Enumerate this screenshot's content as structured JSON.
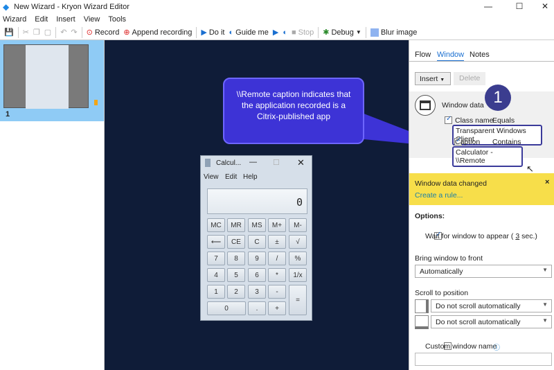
{
  "window": {
    "title": "New Wizard - Kryon Wizard Editor",
    "minimize": "—",
    "maximize": "☐",
    "close": "✕"
  },
  "menu": [
    "Wizard",
    "Edit",
    "Insert",
    "View",
    "Tools"
  ],
  "toolbar": {
    "record": "Record",
    "append": "Append recording",
    "doit": "Do it",
    "guide": "Guide me",
    "stop": "Stop",
    "debug": "Debug",
    "blur": "Blur image"
  },
  "steps": [
    {
      "number": "1"
    }
  ],
  "callout": {
    "text": "\\\\Remote caption indicates that the application recorded is a Citrix-published app",
    "badge": "1"
  },
  "calculator": {
    "title": "Calcul...",
    "menu": [
      "View",
      "Edit",
      "Help"
    ],
    "display": "0",
    "buttons": [
      "MC",
      "MR",
      "MS",
      "M+",
      "M-",
      "⟵",
      "CE",
      "C",
      "±",
      "√",
      "7",
      "8",
      "9",
      "/",
      "%",
      "4",
      "5",
      "6",
      "*",
      "1/x",
      "1",
      "2",
      "3",
      "-",
      "=",
      "0",
      ".",
      "+"
    ]
  },
  "panel": {
    "tabs": [
      "Flow",
      "Window",
      "Notes"
    ],
    "active_tab": "Window",
    "insert": "Insert",
    "delete": "Delete",
    "window_data": "Window data",
    "class_name": {
      "label": "Class name",
      "op": "Equals",
      "value": "Transparent Windows Client",
      "checked": true
    },
    "caption": {
      "label": "Caption",
      "op": "Contains",
      "value": "Calculator - \\\\Remote",
      "checked": true
    },
    "notice": {
      "title": "Window data changed",
      "link": "Create a rule...",
      "close": "×"
    },
    "options_label": "Options:",
    "wait": {
      "pre": "Wait for window to appear (",
      "value": "3",
      "post": "sec.)",
      "checked": true
    },
    "bring_label": "Bring window to front",
    "bring_value": "Automatically",
    "scroll_label": "Scroll to position",
    "scroll_v": "Do not scroll automatically",
    "scroll_h": "Do not scroll automatically",
    "custom_name": {
      "label": "Custom window name",
      "value": "",
      "checked": false
    }
  },
  "colors": {
    "canvas": "#0f1c38",
    "callout": "#3d33d6",
    "badge": "#3b3d8f",
    "notice": "#f7de4a",
    "selection": "#8fcbf5"
  }
}
